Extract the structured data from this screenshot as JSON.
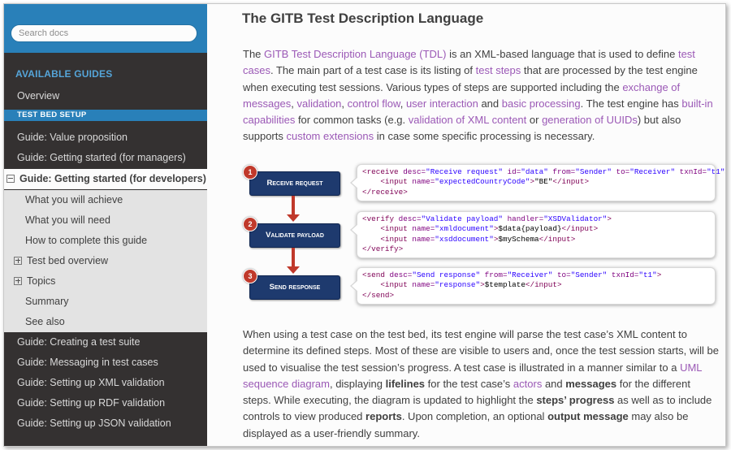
{
  "search": {
    "placeholder": "Search docs"
  },
  "nav": {
    "caption": "AVAILABLE GUIDES",
    "items": [
      {
        "label": "Overview",
        "type": "top"
      },
      {
        "label": "TEST BED SETUP",
        "type": "section"
      },
      {
        "label": "Guide: Value proposition",
        "type": "top"
      },
      {
        "label": "Guide: Getting started (for managers)",
        "type": "top"
      },
      {
        "label": "Guide: Getting started (for developers)",
        "type": "current",
        "toggle": "minus"
      },
      {
        "label": "What you will achieve",
        "type": "sub"
      },
      {
        "label": "What you will need",
        "type": "sub"
      },
      {
        "label": "How to complete this guide",
        "type": "sub"
      },
      {
        "label": "Test bed overview",
        "type": "sub",
        "toggle": "plus"
      },
      {
        "label": "Topics",
        "type": "sub",
        "toggle": "plus"
      },
      {
        "label": "Summary",
        "type": "sub"
      },
      {
        "label": "See also",
        "type": "sub"
      },
      {
        "label": "Guide: Creating a test suite",
        "type": "top"
      },
      {
        "label": "Guide: Messaging in test cases",
        "type": "top"
      },
      {
        "label": "Guide: Setting up XML validation",
        "type": "top"
      },
      {
        "label": "Guide: Setting up RDF validation",
        "type": "top"
      },
      {
        "label": "Guide: Setting up JSON validation",
        "type": "top"
      }
    ]
  },
  "content": {
    "title": "The GITB Test Description Language",
    "p1": [
      {
        "t": "The "
      },
      {
        "a": "GITB Test Description Language (TDL)"
      },
      {
        "t": " is an XML-based language that is used to define "
      },
      {
        "a": "test cases"
      },
      {
        "t": ". The main part of a test case is its listing of "
      },
      {
        "a": "test steps"
      },
      {
        "t": " that are processed by the test engine when executing test sessions. Various types of steps are supported including the "
      },
      {
        "a": "exchange of messages"
      },
      {
        "t": ", "
      },
      {
        "a": "validation"
      },
      {
        "t": ", "
      },
      {
        "a": "control flow"
      },
      {
        "t": ", "
      },
      {
        "a": "user interaction"
      },
      {
        "t": " and "
      },
      {
        "a": "basic processing"
      },
      {
        "t": ". The test engine has "
      },
      {
        "a": "built-in capabilities"
      },
      {
        "t": " for common tasks (e.g. "
      },
      {
        "a": "validation of XML content"
      },
      {
        "t": " or "
      },
      {
        "a": "generation of UUIDs"
      },
      {
        "t": ") but also supports "
      },
      {
        "a": "custom extensions"
      },
      {
        "t": " in case some specific processing is necessary."
      }
    ],
    "p2": [
      {
        "t": "When using a test case on the test bed, its test engine will parse the test case’s XML content to determine its defined steps. Most of these are visible to users and, once the test session starts, will be used to visualise the test session’s progress. A test case is illustrated in a manner similar to a "
      },
      {
        "a": "UML sequence diagram"
      },
      {
        "t": ", displaying "
      },
      {
        "b": "lifelines"
      },
      {
        "t": " for the test case’s "
      },
      {
        "a": "actors"
      },
      {
        "t": " and "
      },
      {
        "b": "messages"
      },
      {
        "t": " for the different steps. While executing, the diagram is updated to highlight the "
      },
      {
        "b": "steps’ progress"
      },
      {
        "t": " as well as to include controls to view produced "
      },
      {
        "b": "reports"
      },
      {
        "t": ". Upon completion, an optional "
      },
      {
        "b": "output message"
      },
      {
        "t": " may also be displayed as a user-friendly summary."
      }
    ]
  },
  "diagram": {
    "steps": [
      {
        "num": "1",
        "label": "Receive request",
        "code": [
          [
            {
              "c": "tg",
              "t": "<receive "
            },
            {
              "c": "at",
              "t": "desc="
            },
            {
              "c": "av",
              "t": "\"Receive request\""
            },
            {
              "c": "at",
              "t": " id="
            },
            {
              "c": "av",
              "t": "\"data\""
            },
            {
              "c": "at",
              "t": " from="
            },
            {
              "c": "av",
              "t": "\"Sender\""
            },
            {
              "c": "at",
              "t": " to="
            },
            {
              "c": "av",
              "t": "\"Receiver\""
            },
            {
              "c": "at",
              "t": " txnId="
            },
            {
              "c": "av",
              "t": "\"t1\""
            },
            {
              "c": "tg",
              "t": ">"
            }
          ],
          [
            {
              "c": "tx",
              "t": "    "
            },
            {
              "c": "tg",
              "t": "<input "
            },
            {
              "c": "at",
              "t": "name="
            },
            {
              "c": "av",
              "t": "\"expectedCountryCode\""
            },
            {
              "c": "tg",
              "t": ">"
            },
            {
              "c": "tx",
              "t": "\"BE\""
            },
            {
              "c": "tg",
              "t": "</input>"
            }
          ],
          [
            {
              "c": "tg",
              "t": "</receive>"
            }
          ]
        ]
      },
      {
        "num": "2",
        "label": "Validate payload",
        "code": [
          [
            {
              "c": "tg",
              "t": "<verify "
            },
            {
              "c": "at",
              "t": "desc="
            },
            {
              "c": "av",
              "t": "\"Validate payload\""
            },
            {
              "c": "at",
              "t": " handler="
            },
            {
              "c": "av",
              "t": "\"XSDValidator\""
            },
            {
              "c": "tg",
              "t": ">"
            }
          ],
          [
            {
              "c": "tx",
              "t": "    "
            },
            {
              "c": "tg",
              "t": "<input "
            },
            {
              "c": "at",
              "t": "name="
            },
            {
              "c": "av",
              "t": "\"xmldocument\""
            },
            {
              "c": "tg",
              "t": ">"
            },
            {
              "c": "tx",
              "t": "$data{payload}"
            },
            {
              "c": "tg",
              "t": "</input>"
            }
          ],
          [
            {
              "c": "tx",
              "t": "    "
            },
            {
              "c": "tg",
              "t": "<input "
            },
            {
              "c": "at",
              "t": "name="
            },
            {
              "c": "av",
              "t": "\"xsddocument\""
            },
            {
              "c": "tg",
              "t": ">"
            },
            {
              "c": "tx",
              "t": "$mySchema"
            },
            {
              "c": "tg",
              "t": "</input>"
            }
          ],
          [
            {
              "c": "tg",
              "t": "</verify>"
            }
          ]
        ]
      },
      {
        "num": "3",
        "label": "Send response",
        "code": [
          [
            {
              "c": "tg",
              "t": "<send "
            },
            {
              "c": "at",
              "t": "desc="
            },
            {
              "c": "av",
              "t": "\"Send response\""
            },
            {
              "c": "at",
              "t": " from="
            },
            {
              "c": "av",
              "t": "\"Receiver\""
            },
            {
              "c": "at",
              "t": " to="
            },
            {
              "c": "av",
              "t": "\"Sender\""
            },
            {
              "c": "at",
              "t": " txnId="
            },
            {
              "c": "av",
              "t": "\"t1\""
            },
            {
              "c": "tg",
              "t": ">"
            }
          ],
          [
            {
              "c": "tx",
              "t": "    "
            },
            {
              "c": "tg",
              "t": "<input "
            },
            {
              "c": "at",
              "t": "name="
            },
            {
              "c": "av",
              "t": "\"response\""
            },
            {
              "c": "tg",
              "t": ">"
            },
            {
              "c": "tx",
              "t": "$template"
            },
            {
              "c": "tg",
              "t": "</input>"
            }
          ],
          [
            {
              "c": "tg",
              "t": "</send>"
            }
          ]
        ]
      }
    ]
  },
  "colors": {
    "accent": "#2980b9",
    "sidebar_bg": "#343131",
    "link": "#9b59b6",
    "step_box": "#1e3a6e",
    "step_num": "#c0392b"
  }
}
